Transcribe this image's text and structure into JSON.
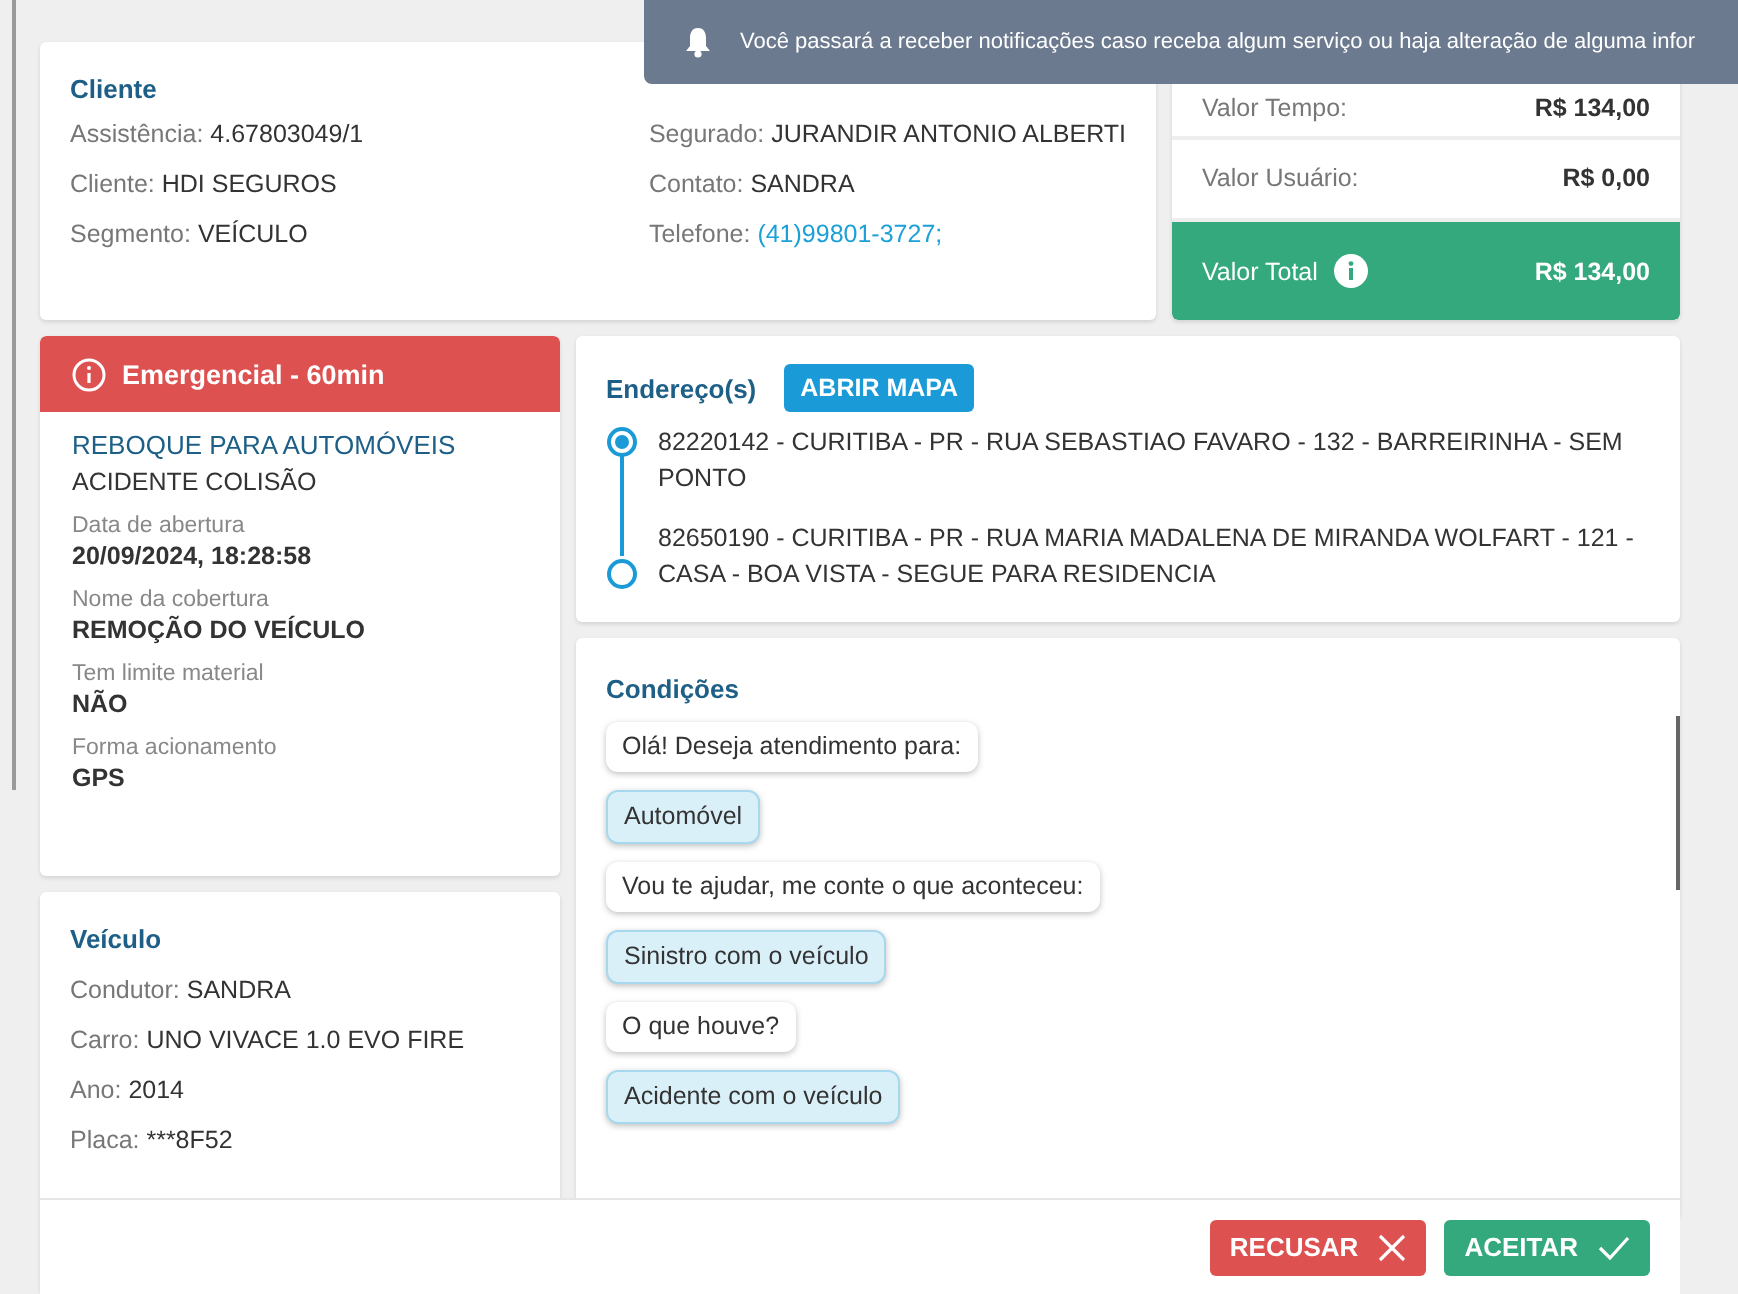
{
  "toast": {
    "text": "Você passará a receber notificações caso receba algum serviço ou haja alteração de alguma infor"
  },
  "client": {
    "title": "Cliente",
    "columns": [
      [
        {
          "label": "Assistência:",
          "value": "4.67803049/1",
          "kind": "text"
        },
        {
          "label": "Cliente:",
          "value": "HDI SEGUROS",
          "kind": "text"
        },
        {
          "label": "Segmento:",
          "value": "VEÍCULO",
          "kind": "text"
        }
      ],
      [
        {
          "label": "Segurado:",
          "value": "JURANDIR ANTONIO ALBERTI",
          "kind": "text"
        },
        {
          "label": "Contato:",
          "value": "SANDRA",
          "kind": "text"
        },
        {
          "label": "Telefone:",
          "value": "(41)99801-3727;",
          "kind": "link"
        }
      ]
    ]
  },
  "values": {
    "rows": [
      {
        "label": "Valor Tempo:",
        "value": "R$ 134,00"
      },
      {
        "label": "Valor Usuário:",
        "value": "R$ 0,00"
      }
    ],
    "total": {
      "label": "Valor Total",
      "value": "R$ 134,00"
    }
  },
  "service": {
    "badge": "Emergencial - 60min",
    "title": "REBOQUE PARA AUTOMÓVEIS",
    "subtitle": "ACIDENTE COLISÃO",
    "fields": [
      {
        "label": "Data de abertura",
        "value": "20/09/2024, 18:28:58"
      },
      {
        "label": "Nome da cobertura",
        "value": "REMOÇÃO DO VEÍCULO"
      },
      {
        "label": "Tem limite material",
        "value": "NÃO"
      },
      {
        "label": "Forma acionamento",
        "value": "GPS"
      }
    ]
  },
  "vehicle": {
    "title": "Veículo",
    "fields": [
      {
        "label": "Condutor:",
        "value": "SANDRA"
      },
      {
        "label": "Carro:",
        "value": "UNO VIVACE 1.0 EVO FIRE"
      },
      {
        "label": "Ano:",
        "value": "2014"
      },
      {
        "label": "Placa:",
        "value": "***8F52"
      }
    ]
  },
  "addresses": {
    "title": "Endereço(s)",
    "button": "ABRIR MAPA",
    "items": [
      {
        "text": "82220142 - CURITIBA - PR - RUA SEBASTIAO FAVARO - 132 - BARREIRINHA - SEM PONTO",
        "kind": "origin"
      },
      {
        "text": "82650190 - CURITIBA - PR - RUA MARIA MADALENA DE MIRANDA WOLFART - 121 - CASA - BOA VISTA - SEGUE PARA RESIDENCIA",
        "kind": "destination"
      }
    ]
  },
  "conditions": {
    "title": "Condições",
    "messages": [
      {
        "text": "Olá! Deseja atendimento para:",
        "kind": "question"
      },
      {
        "text": "Automóvel",
        "kind": "answer"
      },
      {
        "text": "Vou te ajudar, me conte o que aconteceu:",
        "kind": "question"
      },
      {
        "text": "Sinistro com o veículo",
        "kind": "answer"
      },
      {
        "text": "O que houve?",
        "kind": "question"
      },
      {
        "text": "Acidente com o veículo",
        "kind": "answer"
      }
    ]
  },
  "actions": [
    {
      "label": "RECUSAR",
      "kind": "reject"
    },
    {
      "label": "ACEITAR",
      "kind": "accept"
    }
  ]
}
